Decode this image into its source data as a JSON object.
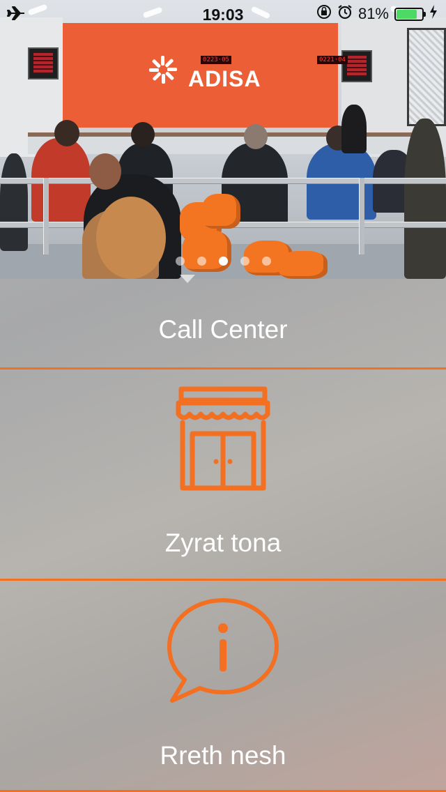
{
  "status_bar": {
    "time": "19:03",
    "battery_percent": "81%",
    "battery_level": 0.81,
    "icons": [
      "airplane-icon",
      "rotation-lock-icon",
      "alarm-icon",
      "battery-icon",
      "charging-icon"
    ]
  },
  "hero": {
    "brand_name": "ADISA",
    "counter_displays": [
      "0223·05",
      "0221·04"
    ],
    "carousel": {
      "page_count": 5,
      "active_index": 2
    }
  },
  "menu": {
    "items": [
      {
        "label": "Call Center",
        "icon": "phone-icon"
      },
      {
        "label": "Zyrat tona",
        "icon": "storefront-icon"
      },
      {
        "label": "Rreth nesh",
        "icon": "info-bubble-icon"
      }
    ]
  },
  "colors": {
    "accent": "#F36F21",
    "text": "#FFFFFF",
    "brand_wall": "#EC5E35"
  }
}
